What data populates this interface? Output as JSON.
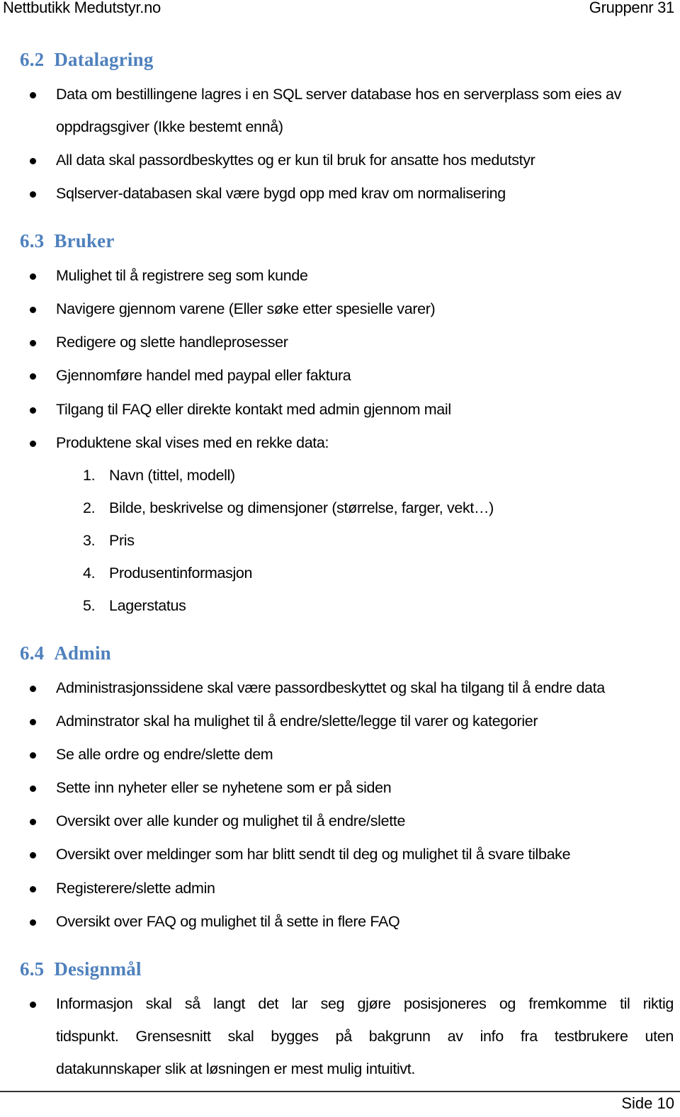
{
  "header": {
    "left": "Nettbutikk Medutstyr.no",
    "right": "Gruppenr 31"
  },
  "sections": [
    {
      "number": "6.2",
      "title": "Datalagring",
      "bullets": [
        "Data om bestillingene lagres i en SQL server database hos en serverplass som eies av",
        "oppdragsgiver (Ikke bestemt ennå)",
        "All data skal passordbeskyttes og er kun til bruk for ansatte hos medutstyr",
        "Sqlserver-databasen skal være bygd opp med krav om normalisering"
      ]
    },
    {
      "number": "6.3",
      "title": "Bruker",
      "bullets": [
        "Mulighet til å registrere seg som kunde",
        "Navigere gjennom varene (Eller søke etter spesielle varer)",
        "Redigere og slette handleprosesser",
        "Gjennomføre handel med paypal eller faktura",
        "Tilgang til FAQ eller direkte kontakt med admin gjennom mail",
        "Produktene skal vises med en rekke data:"
      ],
      "numbered": [
        {
          "n": "1.",
          "text": "Navn (tittel, modell)"
        },
        {
          "n": "2.",
          "text": "Bilde, beskrivelse og dimensjoner (størrelse, farger, vekt…)"
        },
        {
          "n": "3.",
          "text": "Pris"
        },
        {
          "n": "4.",
          "text": "Produsentinformasjon"
        },
        {
          "n": "5.",
          "text": "Lagerstatus"
        }
      ]
    },
    {
      "number": "6.4",
      "title": "Admin",
      "bullets": [
        "Administrasjonssidene skal være passordbeskyttet og skal ha tilgang til å endre data",
        "Adminstrator skal ha mulighet til å endre/slette/legge til varer og kategorier",
        "Se alle ordre og endre/slette dem",
        "Sette inn nyheter eller se nyhetene som er på siden",
        "Oversikt over alle kunder og mulighet til å endre/slette",
        "Oversikt over meldinger som har blitt sendt til deg og mulighet til å svare tilbake",
        "Registerere/slette admin",
        "Oversikt over FAQ og mulighet til å sette in flere FAQ"
      ]
    },
    {
      "number": "6.5",
      "title": "Designmål",
      "paragraph_lines": [
        "Informasjon skal så langt det lar seg gjøre posisjoneres og fremkomme til riktig",
        "tidspunkt. Grensesnitt skal bygges på bakgrunn av info fra testbrukere uten",
        "datakunnskaper slik at løsningen er mest mulig intuitivt."
      ]
    }
  ],
  "footer": {
    "page_label": "Side 10"
  }
}
